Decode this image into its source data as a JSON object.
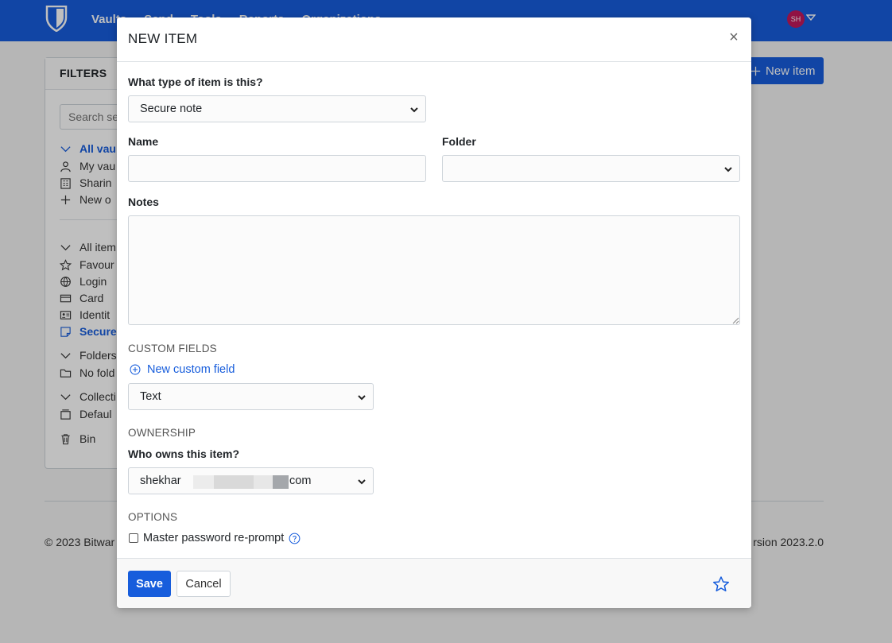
{
  "app": {
    "nav_links": [
      "Vaults",
      "Send",
      "Tools",
      "Reports",
      "Organizations"
    ],
    "avatar_initials": "SH",
    "brand_color": "#175ddc"
  },
  "filters": {
    "title": "FILTERS",
    "search_placeholder": "Search se",
    "items": [
      {
        "label": "All vau",
        "icon": "chevron-down-icon",
        "active": true
      },
      {
        "label": "My vau",
        "icon": "user-icon"
      },
      {
        "label": "Sharin",
        "icon": "building-icon"
      },
      {
        "label": "New o",
        "icon": "plus-icon"
      },
      {
        "label": "All item",
        "icon": "chevron-down-icon"
      },
      {
        "label": "Favour",
        "icon": "star-icon"
      },
      {
        "label": "Login",
        "icon": "globe-icon"
      },
      {
        "label": "Card",
        "icon": "credit-card-icon"
      },
      {
        "label": "Identit",
        "icon": "id-card-icon"
      },
      {
        "label": "Secure",
        "icon": "sticky-note-icon",
        "active": true
      },
      {
        "label": "Folders",
        "icon": "chevron-down-icon"
      },
      {
        "label": "No fold",
        "icon": "folder-icon"
      },
      {
        "label": "Collecti",
        "icon": "chevron-down-icon"
      },
      {
        "label": "Defaul",
        "icon": "cube-icon"
      },
      {
        "label": "Bin",
        "icon": "trash-icon"
      }
    ]
  },
  "new_item_button": "New item",
  "footer": {
    "copyright": "© 2023 Bitwar",
    "version": "rsion 2023.2.0"
  },
  "modal": {
    "title": "NEW ITEM",
    "close_symbol": "×",
    "type_label": "What type of item is this?",
    "type_value": "Secure note",
    "name_label": "Name",
    "name_value": "",
    "folder_label": "Folder",
    "folder_value": "",
    "notes_label": "Notes",
    "notes_value": "",
    "custom_fields_heading": "CUSTOM FIELDS",
    "new_custom_field_link": "New custom field",
    "custom_field_type_value": "Text",
    "ownership_heading": "OWNERSHIP",
    "owner_label": "Who owns this item?",
    "owner_value_prefix": "shekhar",
    "owner_value_suffix": "com",
    "options_heading": "OPTIONS",
    "reprompt_label": "Master password re-prompt",
    "save_label": "Save",
    "cancel_label": "Cancel"
  }
}
